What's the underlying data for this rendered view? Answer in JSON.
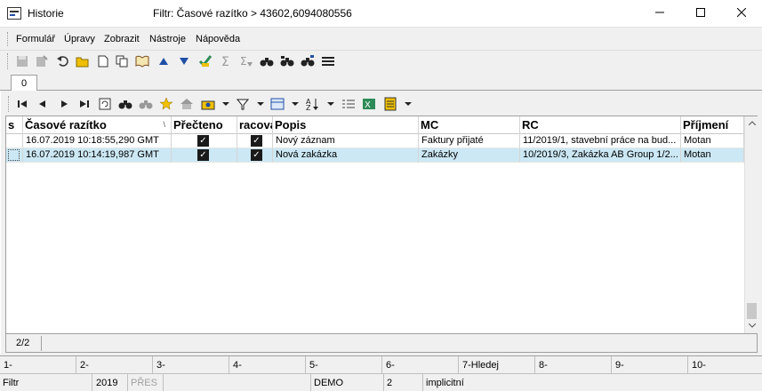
{
  "window": {
    "title": "Historie",
    "filter_title": "Filtr: Časové razítko > 43602,6094080556",
    "minimize_icon": "minimize-icon",
    "maximize_icon": "maximize-icon",
    "close_icon": "close-icon"
  },
  "menu": [
    {
      "label": "Formulář"
    },
    {
      "label": "Úpravy"
    },
    {
      "label": "Zobrazit"
    },
    {
      "label": "Nástroje"
    },
    {
      "label": "Nápověda"
    }
  ],
  "tabs": [
    {
      "label": "0"
    }
  ],
  "grid": {
    "columns": [
      {
        "label": "s"
      },
      {
        "label": "Časové razítko"
      },
      {
        "label": "Přečteno"
      },
      {
        "label": "racová"
      },
      {
        "label": "Popis"
      },
      {
        "label": "MC"
      },
      {
        "label": "RC"
      },
      {
        "label": "Příjmení"
      }
    ],
    "sort_indicator": "\\",
    "rows": [
      {
        "timestamp": "16.07.2019 10:18:55,290 GMT",
        "read": true,
        "work": true,
        "desc": "Nový záznam",
        "mc": "Faktury přijaté",
        "rc": "11/2019/1, stavební práce na bud...",
        "surname": "Motan",
        "selected": false
      },
      {
        "timestamp": "16.07.2019 10:14:19,987 GMT",
        "read": true,
        "work": true,
        "desc": "Nová zakázka",
        "mc": "Zakázky",
        "rc": "10/2019/3, Zakázka AB Group 1/2...",
        "surname": "Motan",
        "selected": true
      }
    ]
  },
  "record_counter": "2/2",
  "check_mark": "✓",
  "function_keys": [
    {
      "label": "1-"
    },
    {
      "label": "2-"
    },
    {
      "label": "3-"
    },
    {
      "label": "4-"
    },
    {
      "label": "5-"
    },
    {
      "label": "6-"
    },
    {
      "label": "7-Hledej"
    },
    {
      "label": "8-"
    },
    {
      "label": "9-"
    },
    {
      "label": "10-"
    }
  ],
  "status": {
    "filter": "Filtr",
    "year": "2019",
    "overwrite": "PŘES",
    "database": "DEMO",
    "number": "2",
    "mode": "implicitní"
  },
  "colors": {
    "selected_row": "#cce8f4",
    "accent_blue": "#1f4fa6",
    "icon_green": "#2e8b57",
    "icon_yellow": "#f0c000"
  }
}
